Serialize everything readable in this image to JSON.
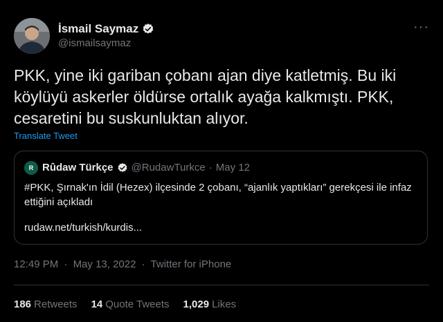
{
  "author": {
    "display_name": "İsmail Saymaz",
    "handle": "@ismailsaymaz",
    "verified_icon": "verified-badge-icon",
    "avatar_icon": "avatar"
  },
  "more_label": "···",
  "tweet_text": "PKK, yine iki gariban çobanı ajan diye katletmiş. Bu iki köylüyü askerler öldürse ortalık ayağa kalkmıştı. PKK, cesaretini bu suskunluktan alıyor.",
  "translate_label": "Translate Tweet",
  "quoted": {
    "avatar_text": "R",
    "display_name": "Rûdaw Türkçe",
    "handle": "@RudawTurkce",
    "separator": "·",
    "date": "May 12",
    "text": "#PKK, Şırnak'ın İdil (Hezex) ilçesinde 2 çobanı, “ajanlık yaptıkları” gerekçesi ile infaz ettiğini açıkladı",
    "link": "rudaw.net/turkish/kurdis..."
  },
  "meta": {
    "time": "12:49 PM",
    "sep1": "·",
    "date": "May 13, 2022",
    "sep2": "·",
    "source": "Twitter for iPhone"
  },
  "stats": [
    {
      "num": "186",
      "label": "Retweets"
    },
    {
      "num": "14",
      "label": "Quote Tweets"
    },
    {
      "num": "1,029",
      "label": "Likes"
    }
  ],
  "colors": {
    "background": "#000000",
    "text": "#e7e9ea",
    "secondary": "#71767b",
    "link": "#1d9bf0",
    "border": "#2f3336"
  }
}
